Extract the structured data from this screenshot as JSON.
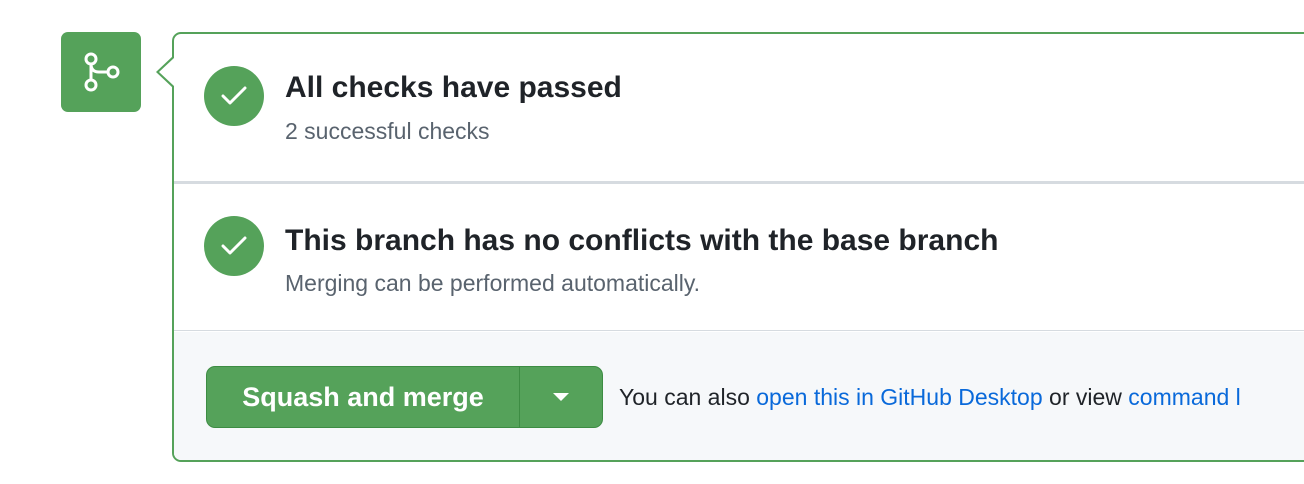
{
  "merge_icon": {
    "icon": "git-merge-icon",
    "color": "#55a25a"
  },
  "checks": {
    "title": "All checks have passed",
    "subtitle": "2 successful checks",
    "icon": "check-icon"
  },
  "conflicts": {
    "title": "This branch has no conflicts with the base branch",
    "subtitle": "Merging can be performed automatically.",
    "icon": "check-icon"
  },
  "merge_actions": {
    "button_label": "Squash and merge",
    "dropdown_icon": "triangle-down-icon",
    "helper_prefix": "You can also",
    "desktop_link": "open this in GitHub Desktop",
    "helper_middle": "or view",
    "cli_link": "command l"
  },
  "colors": {
    "success": "#55a25a",
    "link": "#0969da",
    "footer_bg": "#f6f8fa"
  }
}
